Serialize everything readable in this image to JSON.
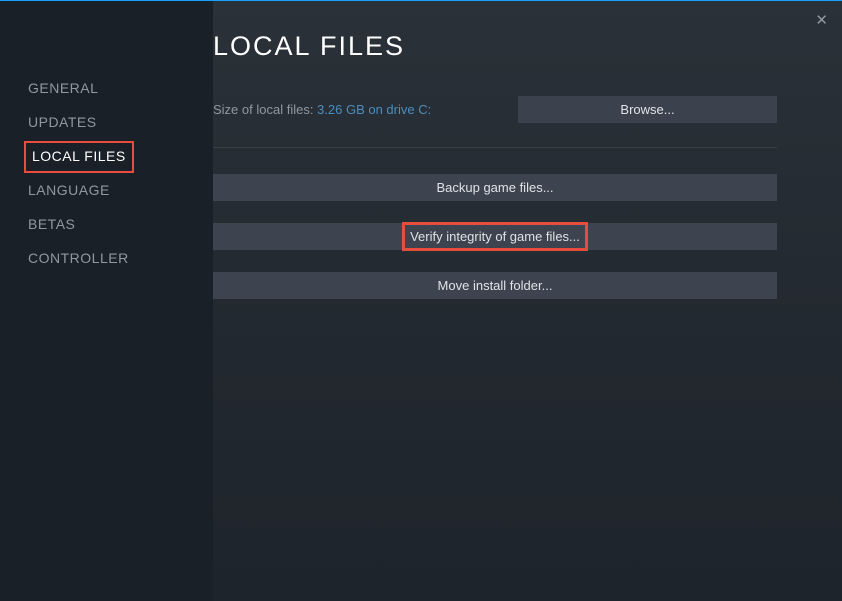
{
  "sidebar": {
    "items": [
      {
        "label": "GENERAL"
      },
      {
        "label": "UPDATES"
      },
      {
        "label": "LOCAL FILES"
      },
      {
        "label": "LANGUAGE"
      },
      {
        "label": "BETAS"
      },
      {
        "label": "CONTROLLER"
      }
    ]
  },
  "main": {
    "title": "LOCAL FILES",
    "size_label": "Size of local files: ",
    "size_value": "3.26 GB on drive C:",
    "browse_label": "Browse...",
    "backup_label": "Backup game files...",
    "verify_label": "Verify integrity of game files...",
    "move_label": "Move install folder..."
  }
}
